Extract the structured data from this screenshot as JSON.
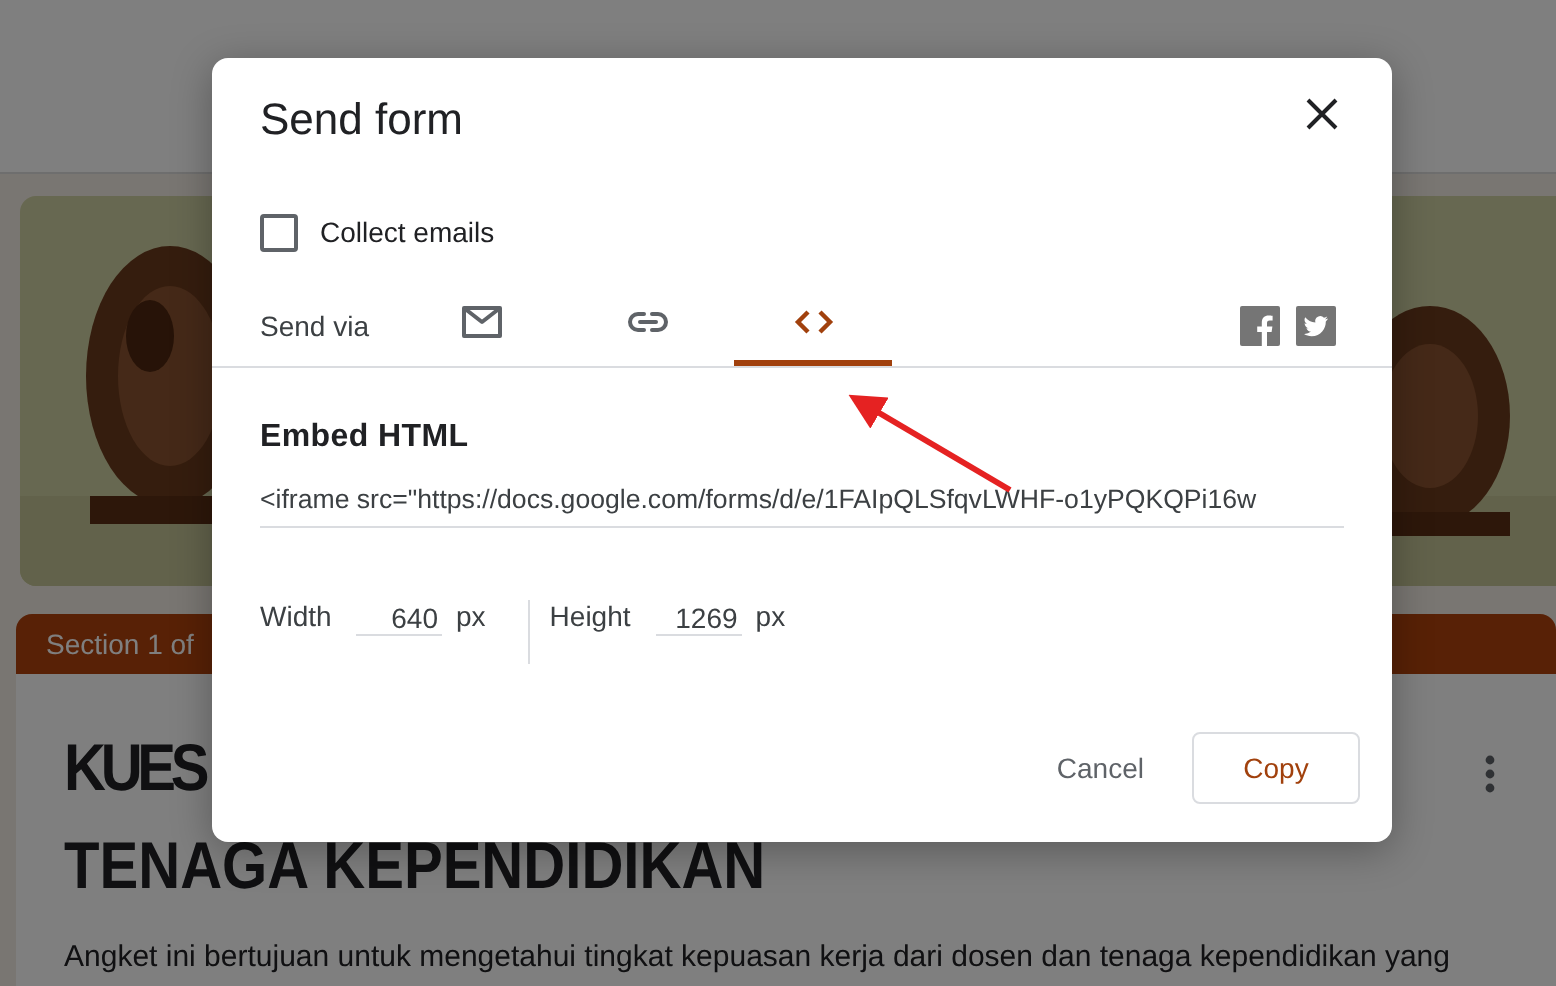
{
  "background_page": {
    "section_tab": "Section 1 of",
    "title_lines": [
      "KUES",
      "TENAGA KEPENDIDIKAN"
    ],
    "description": "Angket ini bertujuan untuk mengetahui tingkat kepuasan kerja dari dosen dan tenaga kependidikan yang"
  },
  "dialog": {
    "title": "Send form",
    "collect_emails": {
      "label": "Collect emails",
      "checked": false
    },
    "send_via": {
      "label": "Send via",
      "tabs": [
        {
          "kind": "email",
          "selected": false
        },
        {
          "kind": "link",
          "selected": false
        },
        {
          "kind": "embed",
          "selected": true
        }
      ],
      "share": [
        {
          "kind": "facebook"
        },
        {
          "kind": "twitter"
        }
      ]
    },
    "embed": {
      "heading": "Embed HTML",
      "code": "<iframe src=\"https://docs.google.com/forms/d/e/1FAIpQLSfqvLWHF-o1yPQKQPi16w",
      "width": {
        "label": "Width",
        "value": "640",
        "unit": "px"
      },
      "height": {
        "label": "Height",
        "value": "1269",
        "unit": "px"
      }
    },
    "buttons": [
      {
        "label": "Cancel",
        "kind": "text"
      },
      {
        "label": "Copy",
        "kind": "outlined"
      }
    ]
  }
}
